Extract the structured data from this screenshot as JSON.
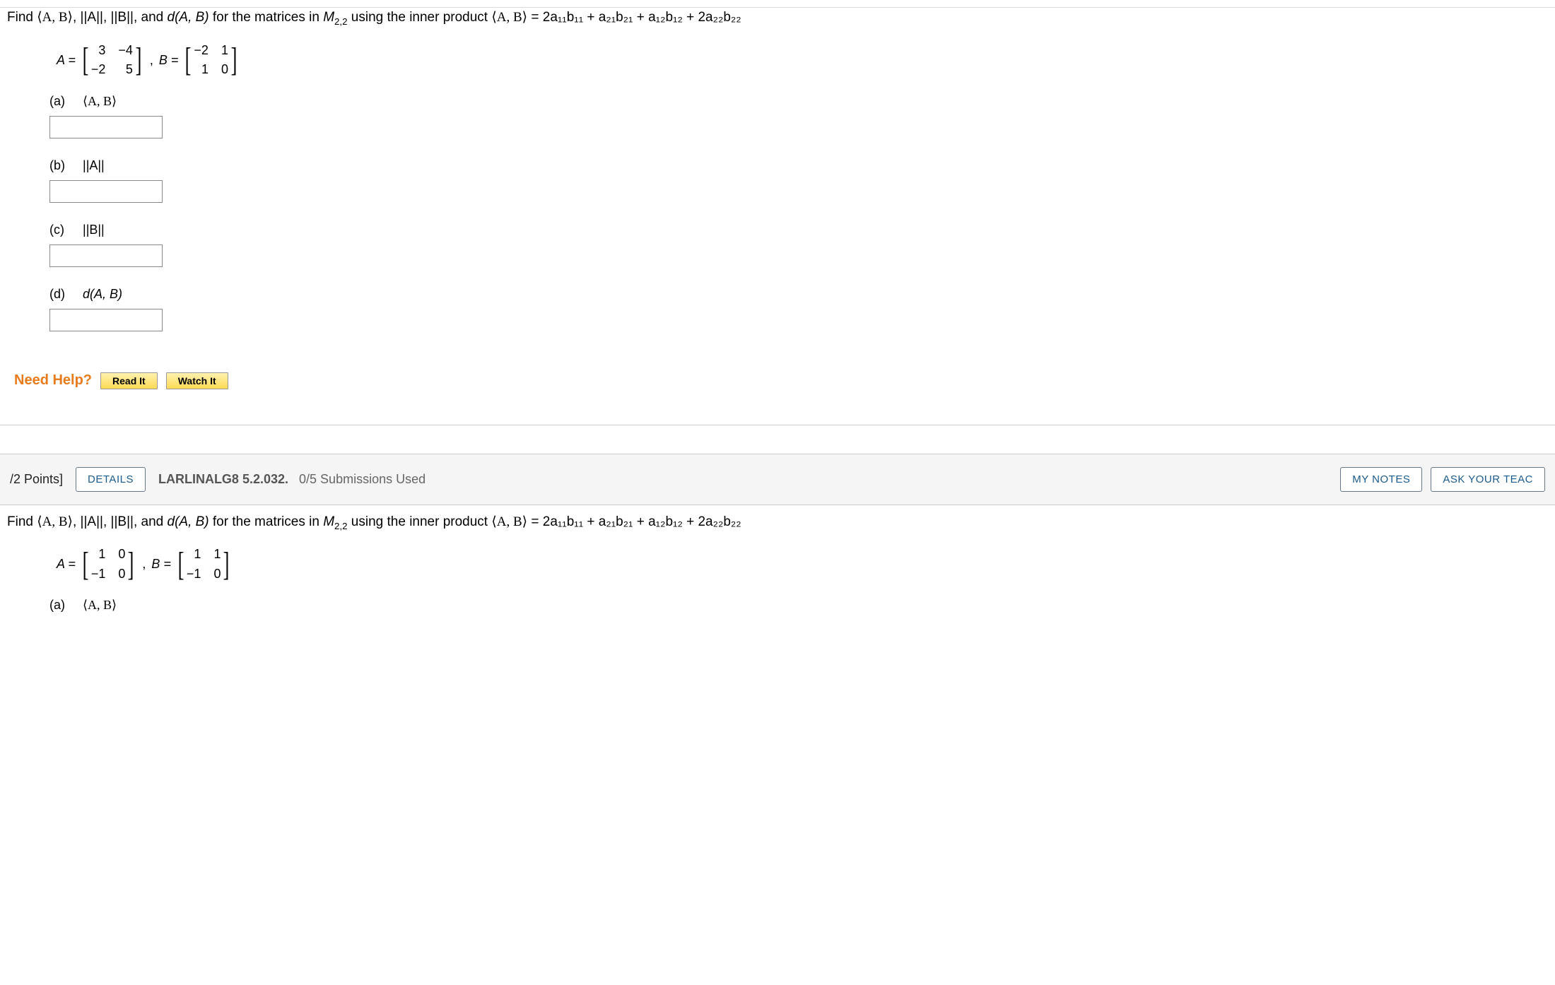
{
  "q1": {
    "prompt_prefix": "Find ",
    "ip_ab": "⟨A, B⟩",
    "norm_a": "||A||",
    "norm_b": "||B||",
    "dist_ab": "d(A, B)",
    "prompt_mid1": " for the matrices in ",
    "space": "M",
    "space_sub": "2,2",
    "prompt_mid2": " using the inner product ",
    "ip_def_lhs": "⟨A, B⟩",
    "ip_def_rhs": " = 2a₁₁b₁₁ + a₂₁b₂₁ + a₁₂b₁₂ + 2a₂₂b₂₂",
    "matrixA": {
      "label": "A =",
      "cells": [
        "3",
        "−4",
        "−2",
        "5"
      ]
    },
    "matrixB": {
      "label": "B =",
      "cells": [
        "−2",
        "1",
        "1",
        "0"
      ]
    },
    "comma": ",",
    "parts": [
      {
        "label": "(a)",
        "expr": "⟨A, B⟩"
      },
      {
        "label": "(b)",
        "expr": "||A||"
      },
      {
        "label": "(c)",
        "expr": "||B||"
      },
      {
        "label": "(d)",
        "expr": "d(A, B)"
      }
    ],
    "need_help": "Need Help?",
    "read_it": "Read It",
    "watch_it": "Watch It"
  },
  "section": {
    "points": "/2 Points]",
    "details": "DETAILS",
    "exercise": "LARLINALG8 5.2.032.",
    "submissions": "0/5 Submissions Used",
    "my_notes": "MY NOTES",
    "ask": "ASK YOUR TEAC"
  },
  "q2": {
    "prompt_prefix": "Find ",
    "ip_ab": "⟨A, B⟩",
    "norm_a": "||A||",
    "norm_b": "||B||",
    "dist_ab": "d(A, B)",
    "prompt_mid1": " for the matrices in ",
    "space": "M",
    "space_sub": "2,2",
    "prompt_mid2": " using the inner product ",
    "ip_def_lhs": "⟨A, B⟩",
    "ip_def_rhs": " = 2a₁₁b₁₁ + a₂₁b₂₁ + a₁₂b₁₂ + 2a₂₂b₂₂",
    "matrixA": {
      "label": "A =",
      "cells": [
        "1",
        "0",
        "−1",
        "0"
      ]
    },
    "matrixB": {
      "label": "B =",
      "cells": [
        "1",
        "1",
        "−1",
        "0"
      ]
    },
    "comma": ",",
    "part_a_label": "(a)",
    "part_a_expr": "⟨A, B⟩"
  }
}
